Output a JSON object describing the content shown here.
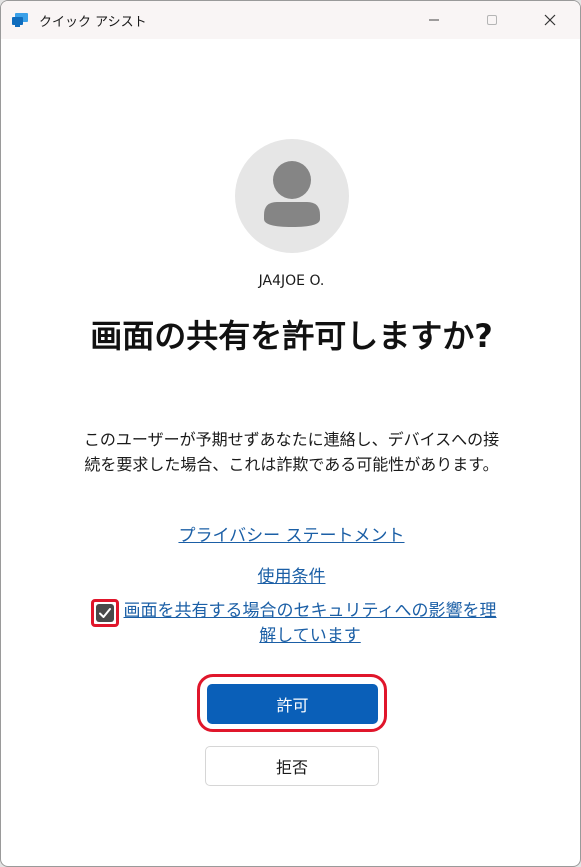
{
  "window": {
    "title": "クイック アシスト",
    "icons": {
      "app": "quick-assist-icon",
      "minimize": "minimize-icon",
      "maximize": "maximize-icon",
      "close": "close-icon"
    }
  },
  "user": {
    "name": "JA4JOE O.",
    "avatar_icon": "person-icon"
  },
  "dialog": {
    "heading": "画面の共有を許可しますか?",
    "description": "このユーザーが予期せずあなたに連絡し、デバイスへの接続を要求した場合、これは詐欺である可能性があります。",
    "privacy_link": "プライバシー ステートメント",
    "terms_link": "使用条件",
    "consent": {
      "checked": true,
      "label": "画面を共有する場合のセキュリティへの影響を理解しています",
      "icon": "checkmark-icon"
    },
    "allow_label": "許可",
    "deny_label": "拒否"
  },
  "colors": {
    "accent": "#0a5fb8",
    "link": "#1b5fa6",
    "highlight": "#e0162b",
    "checkbox": "#4a4a4a"
  }
}
